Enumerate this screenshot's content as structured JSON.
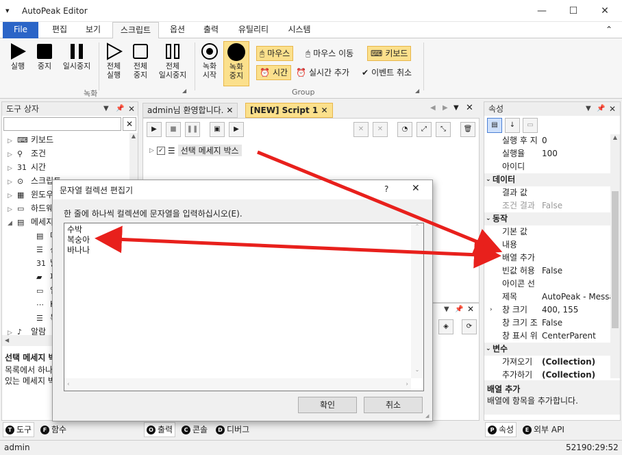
{
  "window": {
    "title": "AutoPeak Editor",
    "minimize": "—",
    "maximize": "☐",
    "close": "✕",
    "system_menu": "▾"
  },
  "menu": {
    "file": "File",
    "tabs": [
      "편집",
      "보기",
      "스크립트",
      "옵션",
      "출력",
      "유틸리티",
      "시스템"
    ],
    "collapse": "⌃"
  },
  "ribbon": {
    "run": "실행",
    "stop": "중지",
    "pause": "일시중지",
    "run_all": "전체\n실행",
    "stop_all": "전체\n중지",
    "pause_all": "전체\n일시중지",
    "rec_start": "녹화\n시작",
    "rec_stop": "녹화\n중지",
    "group_record": "녹화",
    "group_group": "Group",
    "mouse": "마우스",
    "mouse_move": "마우스 이동",
    "keyboard": "키보드",
    "time": "시간",
    "realtime_add": "실시간 추가",
    "event_cancel": "이벤트 취소",
    "highlight_color": "#fbe08c"
  },
  "toolbox": {
    "title": "도구 상자",
    "items": [
      {
        "label": "키보드",
        "icon": "⌨",
        "arrow": "▷"
      },
      {
        "label": "조건",
        "icon": "⚲",
        "arrow": "▷"
      },
      {
        "label": "시간",
        "icon": "31",
        "arrow": "▷"
      },
      {
        "label": "스크립트",
        "icon": "⊙",
        "arrow": "▷"
      },
      {
        "label": "윈도우",
        "icon": "▦",
        "arrow": "▷"
      },
      {
        "label": "하드웨어",
        "icon": "▭",
        "arrow": "▷"
      },
      {
        "label": "메세지",
        "icon": "▤",
        "arrow": "◢"
      },
      {
        "label": "메",
        "icon": "▤",
        "arrow": ""
      },
      {
        "label": "선",
        "icon": "☰",
        "arrow": ""
      },
      {
        "label": "날",
        "icon": "31",
        "arrow": ""
      },
      {
        "label": "파",
        "icon": "▰",
        "arrow": ""
      },
      {
        "label": "입",
        "icon": "▭",
        "arrow": ""
      },
      {
        "label": "Ke",
        "icon": "⋯",
        "arrow": ""
      },
      {
        "label": "목",
        "icon": "☰",
        "arrow": ""
      },
      {
        "label": "알람",
        "icon": "♪",
        "arrow": "▷"
      }
    ],
    "desc_title": "선택 메세지 박",
    "desc_line1": "목록에서 하나",
    "desc_line2": "있는 메세지 박",
    "tab_tool": "도구",
    "tab_func": "함수"
  },
  "editor": {
    "tabs": [
      "admin님 환영합니다.",
      "[NEW] Script 1"
    ],
    "node_label": "선택 메세지 박스",
    "bottom_tabs": [
      "출력",
      "콘솔",
      "디버그"
    ]
  },
  "props": {
    "title": "속성",
    "rows": [
      {
        "k": "실행 후 지",
        "v": "0",
        "cat": false
      },
      {
        "k": "실행율",
        "v": "100",
        "cat": false
      },
      {
        "k": "아이디",
        "v": "",
        "cat": false
      },
      {
        "k": "데이터",
        "v": "",
        "cat": true
      },
      {
        "k": "결과 값",
        "v": "",
        "cat": false
      },
      {
        "k": "조건 결과",
        "v": "False",
        "cat": false
      },
      {
        "k": "동작",
        "v": "",
        "cat": true
      },
      {
        "k": "기본 값",
        "v": "",
        "cat": false
      },
      {
        "k": "내용",
        "v": "",
        "cat": false
      },
      {
        "k": "배열 추가",
        "v": "",
        "cat": false
      },
      {
        "k": "빈값 허용",
        "v": "False",
        "cat": false
      },
      {
        "k": "아이콘 선",
        "v": "",
        "cat": false
      },
      {
        "k": "제목",
        "v": "AutoPeak - Messa",
        "cat": false
      },
      {
        "k": "창 크기",
        "v": "400, 155",
        "cat": false
      },
      {
        "k": "창 크기 조",
        "v": "False",
        "cat": false
      },
      {
        "k": "창 표시 위",
        "v": "CenterParent",
        "cat": false
      },
      {
        "k": "변수",
        "v": "",
        "cat": true
      },
      {
        "k": "가져오기",
        "v": "(Collection)",
        "cat": false
      },
      {
        "k": "추가하기",
        "v": "(Collection)",
        "cat": false
      }
    ],
    "desc_title": "배열 추가",
    "desc_text": "배열에 항목을 추가합니다.",
    "tab_props": "속성",
    "tab_api": "외부 API"
  },
  "dialog": {
    "title": "문자열 컬렉션 편집기",
    "help": "?",
    "close": "✕",
    "instruction": "한 줄에 하나씩 컬렉션에 문자열을 입력하십시오(E).",
    "lines": [
      "수박",
      "복숭아",
      "바나나"
    ],
    "ok": "확인",
    "cancel": "취소"
  },
  "status": {
    "user": "admin",
    "time": "52190:29:52"
  },
  "colors": {
    "arrow": "#e8201c",
    "file_tab": "#2b65c7"
  }
}
